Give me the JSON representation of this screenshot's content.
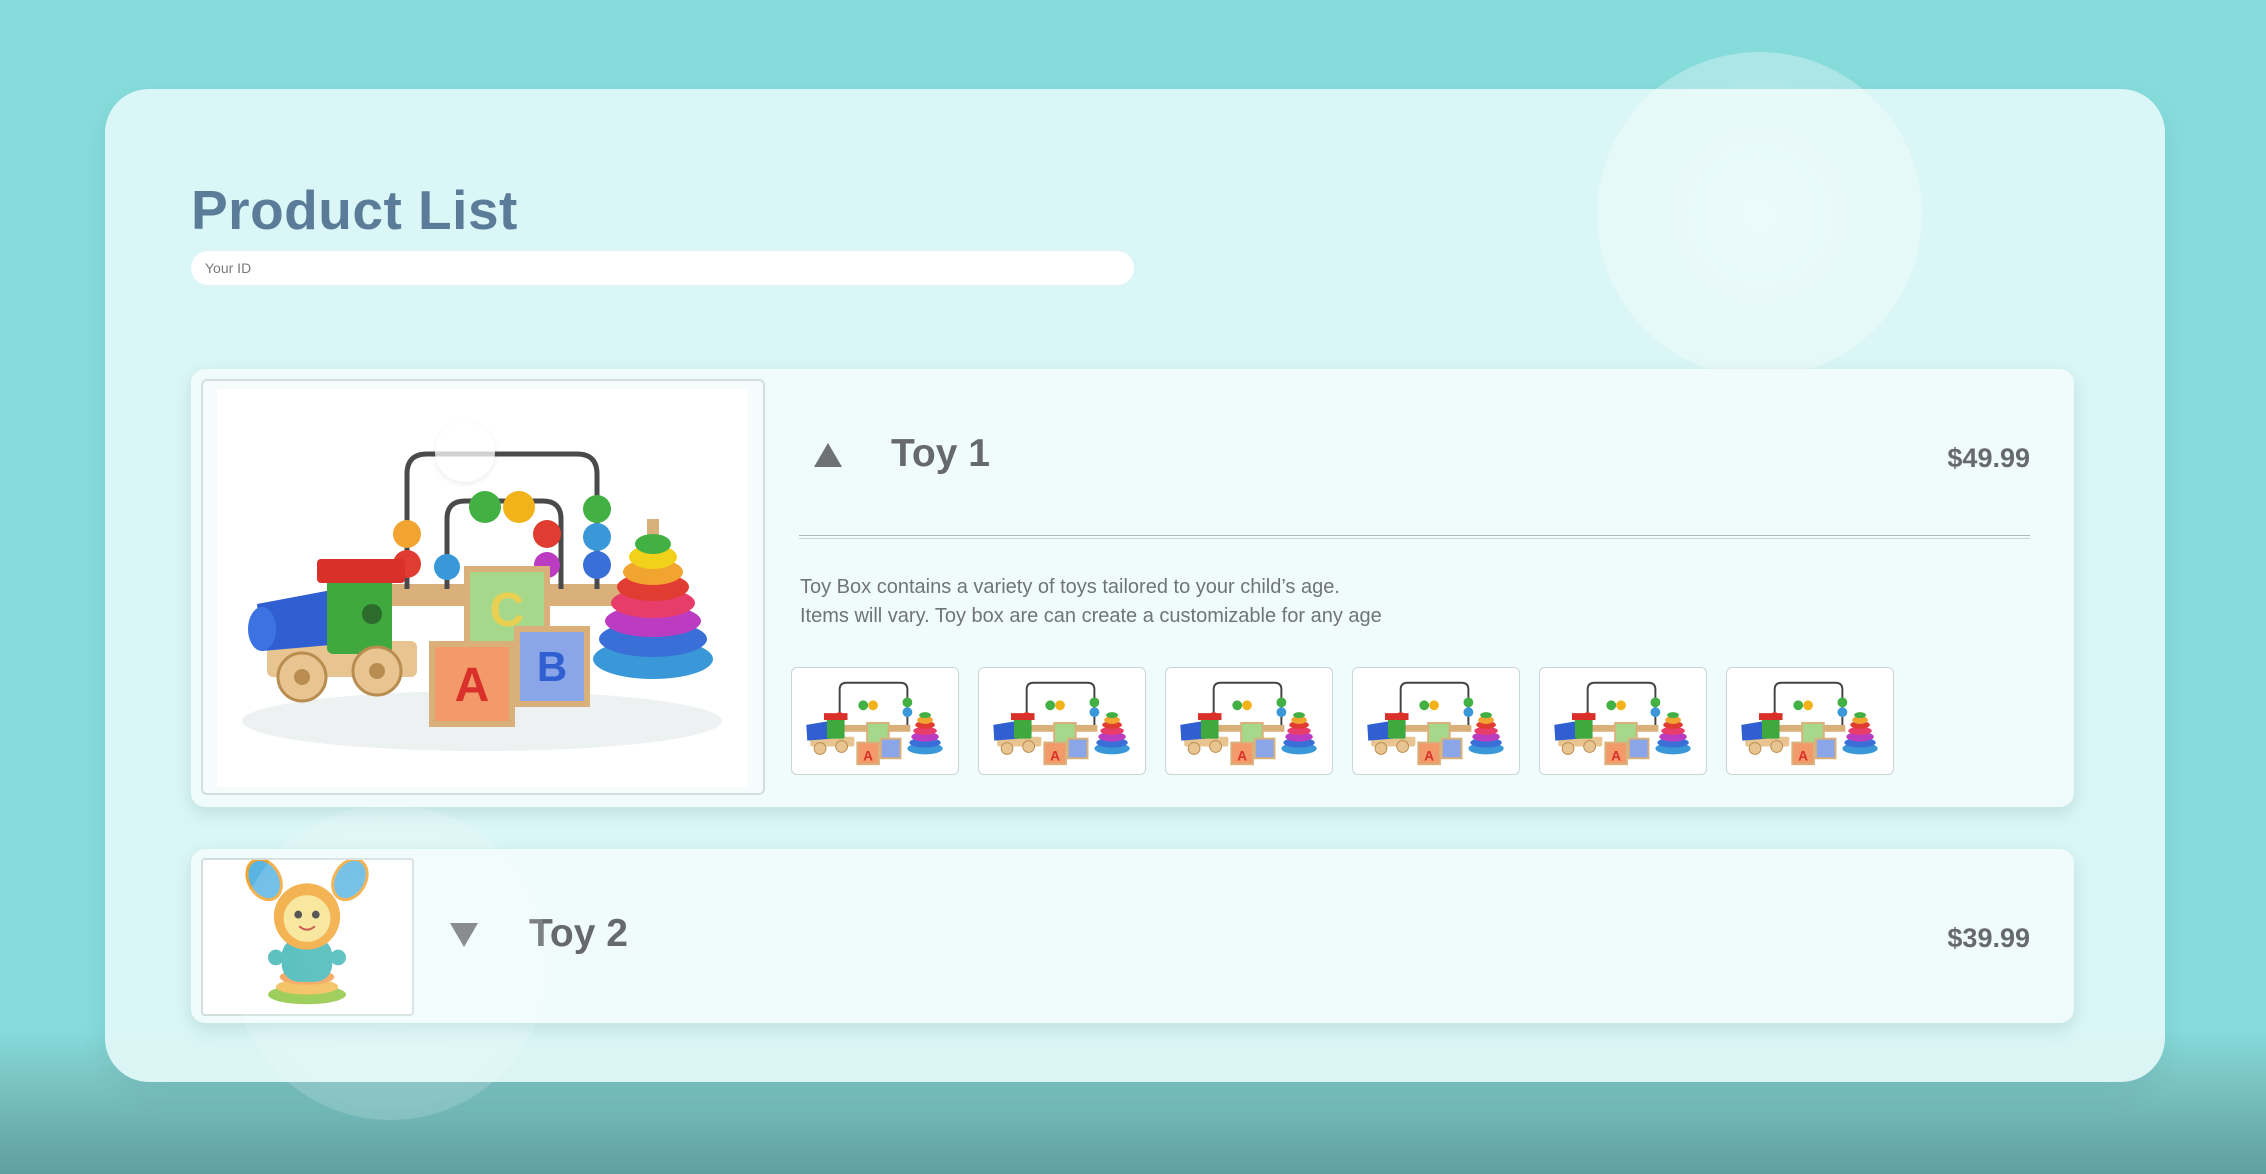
{
  "page": {
    "title": "Product List",
    "search": {
      "placeholder": "Your ID",
      "value": ""
    }
  },
  "colors": {
    "background": "#86dbdb",
    "panel": "#e2f8f8",
    "title": "#5b7c99",
    "text": "#666a6e"
  },
  "products": [
    {
      "name": "Toy 1",
      "price": "$49.99",
      "expanded": true,
      "toggle_icon": "triangle-up-icon",
      "image_icon": "toy-set-image",
      "description": [
        "Toy Box contains a variety of toys tailored to your child’s age.",
        "Items will vary. Toy box are can create a customizable for any age"
      ],
      "thumbnail_count": 6
    },
    {
      "name": "Toy 2",
      "price": "$39.99",
      "expanded": false,
      "toggle_icon": "triangle-down-icon",
      "image_icon": "plush-toy-image"
    }
  ]
}
